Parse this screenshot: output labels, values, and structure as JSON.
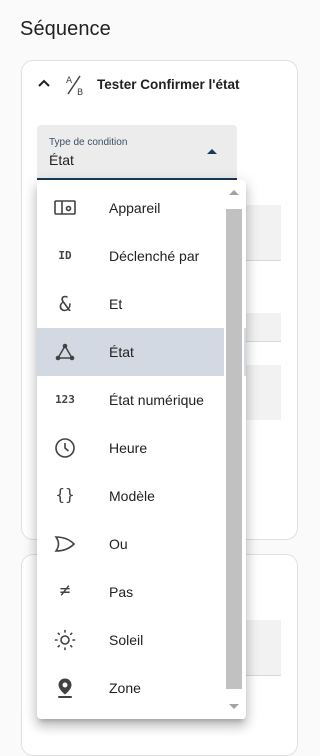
{
  "page": {
    "title": "Séquence"
  },
  "card1": {
    "title": "Tester Confirmer l'état"
  },
  "condition_field": {
    "label": "Type de condition",
    "value": "État"
  },
  "menu": {
    "items": [
      {
        "label": "Appareil",
        "icon": "device-icon"
      },
      {
        "label": "Déclenché par",
        "icon": "id-icon",
        "icon_text": "ID"
      },
      {
        "label": "Et",
        "icon": "ampersand-icon",
        "icon_text": "&"
      },
      {
        "label": "État",
        "icon": "state-icon",
        "selected": true
      },
      {
        "label": "État numérique",
        "icon": "numeric-icon",
        "icon_text": "123"
      },
      {
        "label": "Heure",
        "icon": "clock-icon"
      },
      {
        "label": "Modèle",
        "icon": "template-icon",
        "icon_text": "{}"
      },
      {
        "label": "Ou",
        "icon": "or-gate-icon"
      },
      {
        "label": "Pas",
        "icon": "not-equal-icon",
        "icon_text": "≠"
      },
      {
        "label": "Soleil",
        "icon": "sun-icon"
      },
      {
        "label": "Zone",
        "icon": "zone-icon"
      }
    ]
  },
  "colors": {
    "accent": "#1a3a5a",
    "selected_bg": "#d3d9e2",
    "field_bg": "#ececec"
  }
}
